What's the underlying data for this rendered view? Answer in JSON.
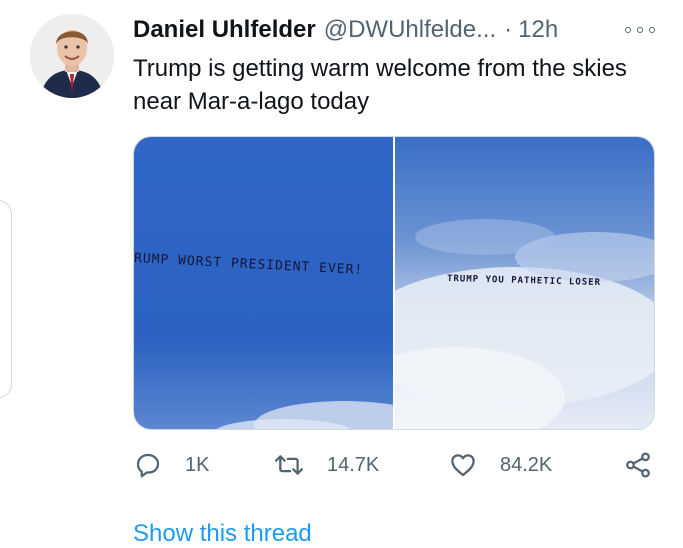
{
  "tweet": {
    "author_name": "Daniel Uhlfelder",
    "handle": "@DWUhlfelde...",
    "separator": "·",
    "time": "12h",
    "text": "Trump is getting warm welcome from the skies near Mar-a-lago today"
  },
  "media": {
    "photo_left_banner": "RUMP WORST PRESIDENT EVER!",
    "photo_right_banner": "TRUMP YOU PATHETIC LOSER"
  },
  "actions": {
    "reply_count": "1K",
    "retweet_count": "14.7K",
    "like_count": "84.2K"
  },
  "footer": {
    "thread_link": "Show this thread"
  },
  "colors": {
    "link_blue": "#1d9bf0",
    "muted_gray": "#536471",
    "sky_blue": "#2d63c4"
  },
  "icons": [
    "more-icon",
    "reply-icon",
    "retweet-icon",
    "like-icon",
    "share-icon"
  ]
}
